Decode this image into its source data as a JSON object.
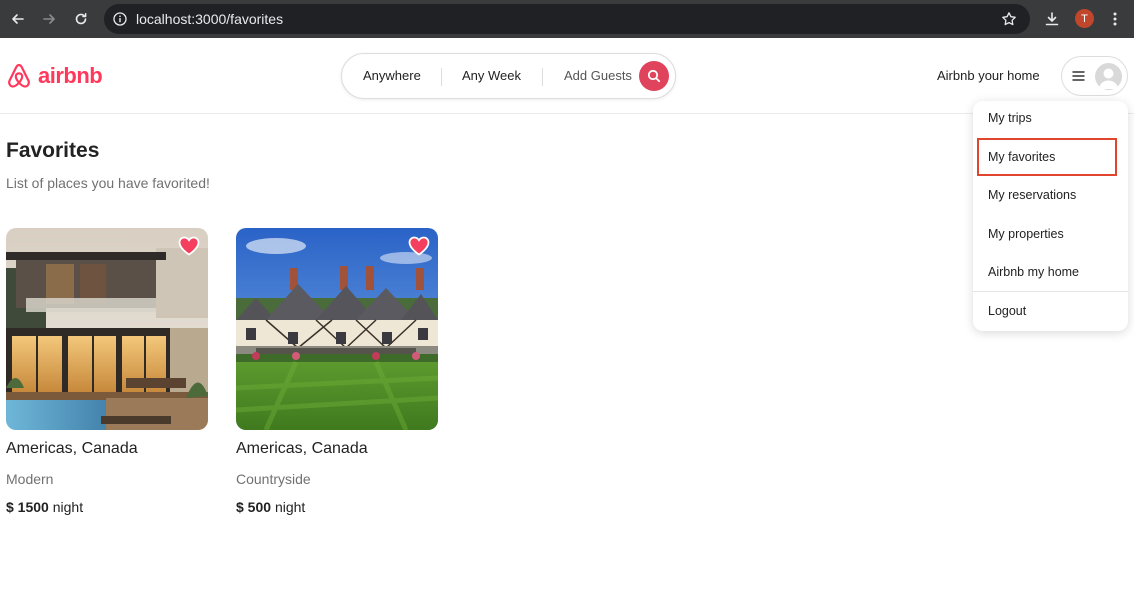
{
  "browser": {
    "url": "localhost:3000/favorites",
    "profile_initial": "T"
  },
  "header": {
    "logo_text": "airbnb",
    "search": {
      "where": "Anywhere",
      "when": "Any Week",
      "who": "Add Guests"
    },
    "host_link": "Airbnb your home"
  },
  "menu": {
    "items": [
      {
        "label": "My trips"
      },
      {
        "label": "My favorites"
      },
      {
        "label": "My reservations"
      },
      {
        "label": "My properties"
      },
      {
        "label": "Airbnb my home"
      },
      {
        "label": "Logout"
      }
    ],
    "highlighted": "My favorites"
  },
  "page": {
    "title": "Favorites",
    "subtitle": "List of places you have favorited!"
  },
  "listings": [
    {
      "location": "Americas, Canada",
      "category": "Modern",
      "price": "$ 1500",
      "unit": "night",
      "favorited": true
    },
    {
      "location": "Americas, Canada",
      "category": "Countryside",
      "price": "$ 500",
      "unit": "night",
      "favorited": true
    }
  ],
  "colors": {
    "brand": "#ff385c",
    "search_button": "#e0445c",
    "heart": "#f43f5e",
    "highlight_border": "#e0452f"
  },
  "icons": {
    "back": "arrow-left-icon",
    "forward": "arrow-right-icon",
    "reload": "reload-icon",
    "site_info": "info-icon",
    "bookmark": "star-icon",
    "download": "download-icon",
    "more": "more-vertical-icon",
    "search": "search-icon",
    "menu": "hamburger-icon",
    "favorite": "heart-icon"
  }
}
